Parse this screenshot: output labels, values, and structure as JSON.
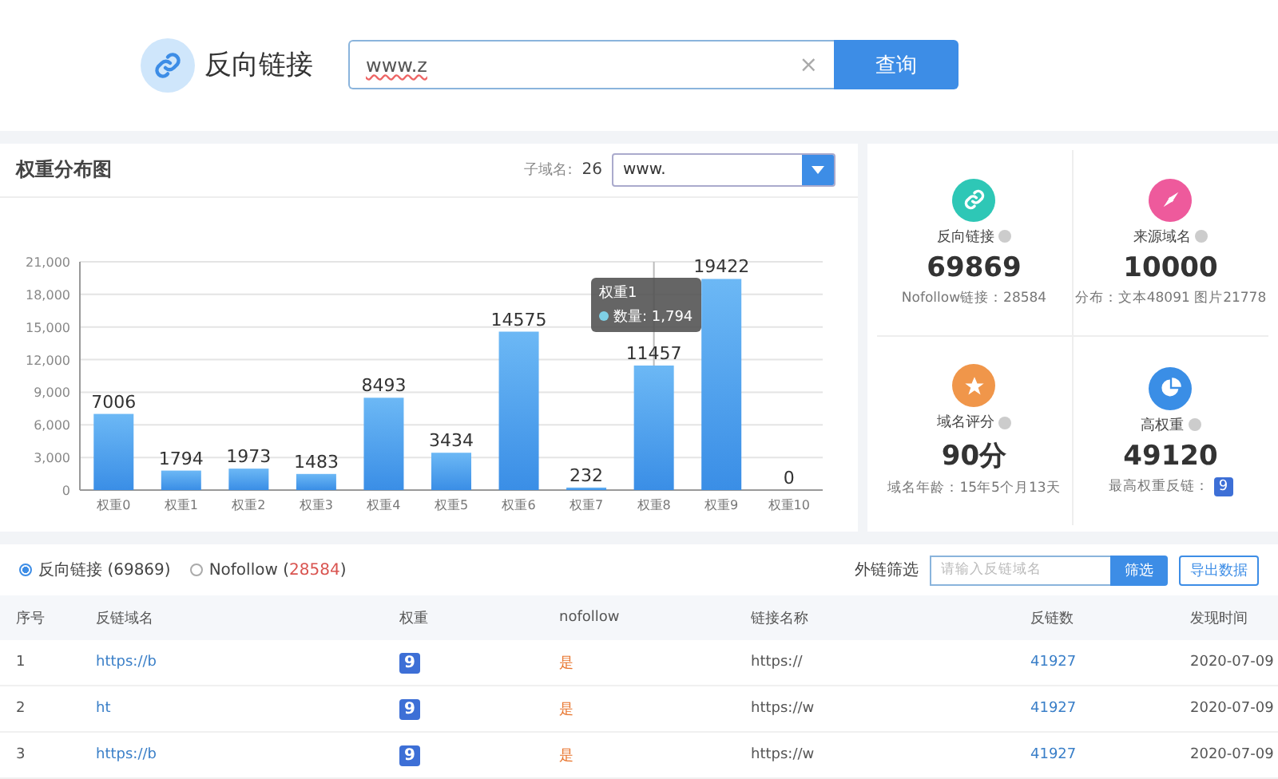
{
  "header": {
    "title": "反向链接",
    "search": {
      "value": "www.z",
      "clear": "×",
      "button": "查询"
    }
  },
  "chart_panel": {
    "title": "权重分布图",
    "subdomain_label": "子域名:",
    "subdomain_count": "26",
    "subdomain_select": "www.",
    "chart_data": {
      "type": "bar",
      "categories": [
        "权重0",
        "权重1",
        "权重2",
        "权重3",
        "权重4",
        "权重5",
        "权重6",
        "权重7",
        "权重8",
        "权重9",
        "权重10"
      ],
      "values": [
        7006,
        1794,
        1973,
        1483,
        8493,
        3434,
        14575,
        232,
        11457,
        19422,
        0
      ],
      "ylim": [
        0,
        21000
      ],
      "grid": true,
      "ref_lines": [
        {
          "axis": "x",
          "value": "权重8"
        }
      ],
      "yticks": [
        {
          "value": 0,
          "label": "0"
        },
        {
          "value": 3000,
          "label": "3,000"
        },
        {
          "value": 6000,
          "label": "6,000"
        },
        {
          "value": 9000,
          "label": "9,000"
        },
        {
          "value": 12000,
          "label": "12,000"
        },
        {
          "value": 15000,
          "label": "15,000"
        },
        {
          "value": 18000,
          "label": "18,000"
        },
        {
          "value": 21000,
          "label": "21,000"
        }
      ],
      "data_labels": true
    },
    "tooltip": {
      "title": "权重1",
      "label": "数量: 1,794"
    }
  },
  "stats": [
    {
      "kind": "link",
      "color": "#2ec7b6",
      "label": "反向链接",
      "value": "69869",
      "note": "Nofollow链接：28584"
    },
    {
      "kind": "compass",
      "color": "#ee5a9c",
      "label": "来源域名",
      "value": "10000",
      "note": "分布：文本48091 图片21778"
    },
    {
      "kind": "star",
      "color": "#f0964a",
      "label": "域名评分",
      "value": "90分",
      "note": "域名年龄：15年5个月13天"
    },
    {
      "kind": "pie",
      "color": "#3a8ee6",
      "label": "高权重",
      "value": "49120",
      "note": "最高权重反链：",
      "badge": "9"
    }
  ],
  "filters": {
    "options": [
      {
        "label": "反向链接",
        "count": "(69869)",
        "selected": true
      },
      {
        "label": "Nofollow",
        "open": "(",
        "count": "28584",
        "close": ")",
        "selected": false
      }
    ],
    "filter_label": "外链筛选",
    "filter_placeholder": "请输入反链域名",
    "filter_button": "筛选",
    "export_button": "导出数据"
  },
  "table": {
    "columns": [
      "序号",
      "反链域名",
      "权重",
      "nofollow",
      "链接名称",
      "反链数",
      "发现时间"
    ],
    "rows": [
      {
        "index": "1",
        "domain": "https://b",
        "weight": "9",
        "nofollow": "是",
        "link_name": "https://",
        "backlinks": "41927",
        "date": "2020-07-09"
      },
      {
        "index": "2",
        "domain": "ht",
        "weight": "9",
        "nofollow": "是",
        "link_name": "https://w",
        "backlinks": "41927",
        "date": "2020-07-09"
      },
      {
        "index": "3",
        "domain": "https://b",
        "weight": "9",
        "nofollow": "是",
        "link_name": "https://w",
        "backlinks": "41927",
        "date": "2020-07-09"
      }
    ]
  }
}
